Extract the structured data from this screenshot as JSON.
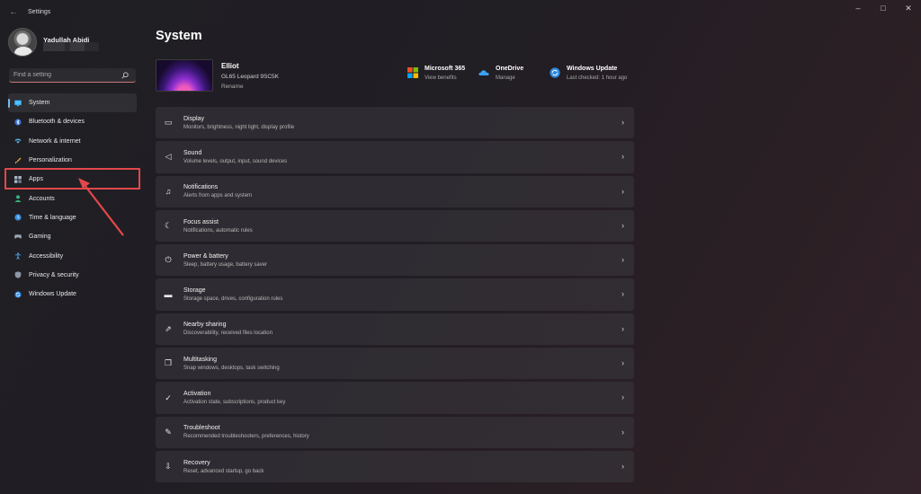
{
  "window": {
    "title": "Settings",
    "back_glyph": "←",
    "minimize_glyph": "–",
    "maximize_glyph": "□",
    "close_glyph": "✕"
  },
  "profile": {
    "name": "Yadullah Abidi"
  },
  "search": {
    "placeholder": "Find a setting"
  },
  "sidebar": {
    "items": [
      {
        "label": "System",
        "icon": "display-icon",
        "active": true
      },
      {
        "label": "Bluetooth & devices",
        "icon": "bluetooth-icon"
      },
      {
        "label": "Network & internet",
        "icon": "wifi-icon"
      },
      {
        "label": "Personalization",
        "icon": "brush-icon"
      },
      {
        "label": "Apps",
        "icon": "apps-icon"
      },
      {
        "label": "Accounts",
        "icon": "person-icon"
      },
      {
        "label": "Time & language",
        "icon": "globe-clock-icon"
      },
      {
        "label": "Gaming",
        "icon": "gamepad-icon"
      },
      {
        "label": "Accessibility",
        "icon": "accessibility-icon"
      },
      {
        "label": "Privacy & security",
        "icon": "shield-icon"
      },
      {
        "label": "Windows Update",
        "icon": "update-icon"
      }
    ]
  },
  "main": {
    "title": "System",
    "device": {
      "name": "Elliot",
      "model": "GL65 Leopard 9SC5K",
      "rename": "Rename"
    },
    "services": [
      {
        "title": "Microsoft 365",
        "sub": "View benefits",
        "icon": "microsoft-365-icon"
      },
      {
        "title": "OneDrive",
        "sub": "Manage",
        "icon": "onedrive-icon"
      },
      {
        "title": "Windows Update",
        "sub": "Last checked: 1 hour ago",
        "icon": "windows-update-icon"
      }
    ],
    "rows": [
      {
        "title": "Display",
        "sub": "Monitors, brightness, night light, display profile",
        "icon": "monitor-icon",
        "glyph": "▭"
      },
      {
        "title": "Sound",
        "sub": "Volume levels, output, input, sound devices",
        "icon": "speaker-icon",
        "glyph": "◁"
      },
      {
        "title": "Notifications",
        "sub": "Alerts from apps and system",
        "icon": "bell-icon",
        "glyph": "♫"
      },
      {
        "title": "Focus assist",
        "sub": "Notifications, automatic rules",
        "icon": "moon-icon",
        "glyph": "☾"
      },
      {
        "title": "Power & battery",
        "sub": "Sleep, battery usage, battery saver",
        "icon": "power-icon",
        "glyph": "⏻"
      },
      {
        "title": "Storage",
        "sub": "Storage space, drives, configuration rules",
        "icon": "drive-icon",
        "glyph": "▬"
      },
      {
        "title": "Nearby sharing",
        "sub": "Discoverability, received files location",
        "icon": "share-icon",
        "glyph": "⇗"
      },
      {
        "title": "Multitasking",
        "sub": "Snap windows, desktops, task switching",
        "icon": "windows-stack-icon",
        "glyph": "❐"
      },
      {
        "title": "Activation",
        "sub": "Activation state, subscriptions, product key",
        "icon": "check-circle-icon",
        "glyph": "✓"
      },
      {
        "title": "Troubleshoot",
        "sub": "Recommended troubleshooters, preferences, history",
        "icon": "wrench-icon",
        "glyph": "✎"
      },
      {
        "title": "Recovery",
        "sub": "Reset, advanced startup, go back",
        "icon": "recovery-icon",
        "glyph": "⇩"
      }
    ],
    "chevron": "›"
  },
  "annotation": {
    "highlight_color": "#e2484b"
  }
}
